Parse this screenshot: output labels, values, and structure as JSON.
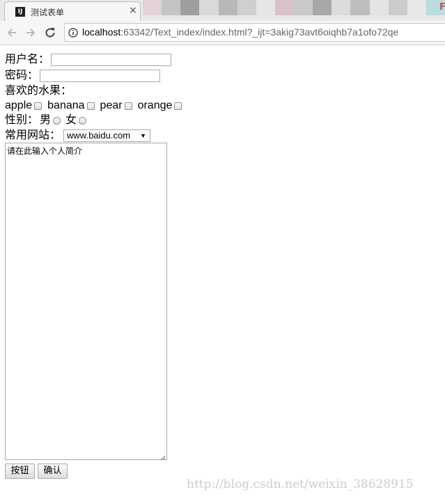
{
  "browser": {
    "tab": {
      "favicon_text": "IJ",
      "title": "测试表单",
      "close_glyph": "×"
    },
    "url": {
      "host": "localhost",
      "rest": ":63342/Text_index/index.html?_ijt=3akig73avt6oiqhb7a1ofo72qe"
    },
    "icons": {
      "back": "back-arrow-icon",
      "forward": "forward-arrow-icon",
      "reload": "reload-icon",
      "info": "info-icon"
    }
  },
  "form": {
    "username_label": "用户名：",
    "username_value": "",
    "password_label": "密码：",
    "password_value": "",
    "fruits_label": "喜欢的水果：",
    "fruits": [
      {
        "label": "apple",
        "checked": false
      },
      {
        "label": "banana",
        "checked": false
      },
      {
        "label": "pear",
        "checked": false
      },
      {
        "label": "orange",
        "checked": false
      }
    ],
    "gender_label": "性别：",
    "genders": [
      {
        "label": "男",
        "selected": false
      },
      {
        "label": "女",
        "selected": false
      }
    ],
    "website_label": "常用网站：",
    "website_selected": "www.baidu.com",
    "bio_text": "请在此输入个人简介",
    "button1_label": "按钮",
    "button2_label": "确认"
  },
  "watermark": "http://blog.csdn.net/weixin_38628915"
}
